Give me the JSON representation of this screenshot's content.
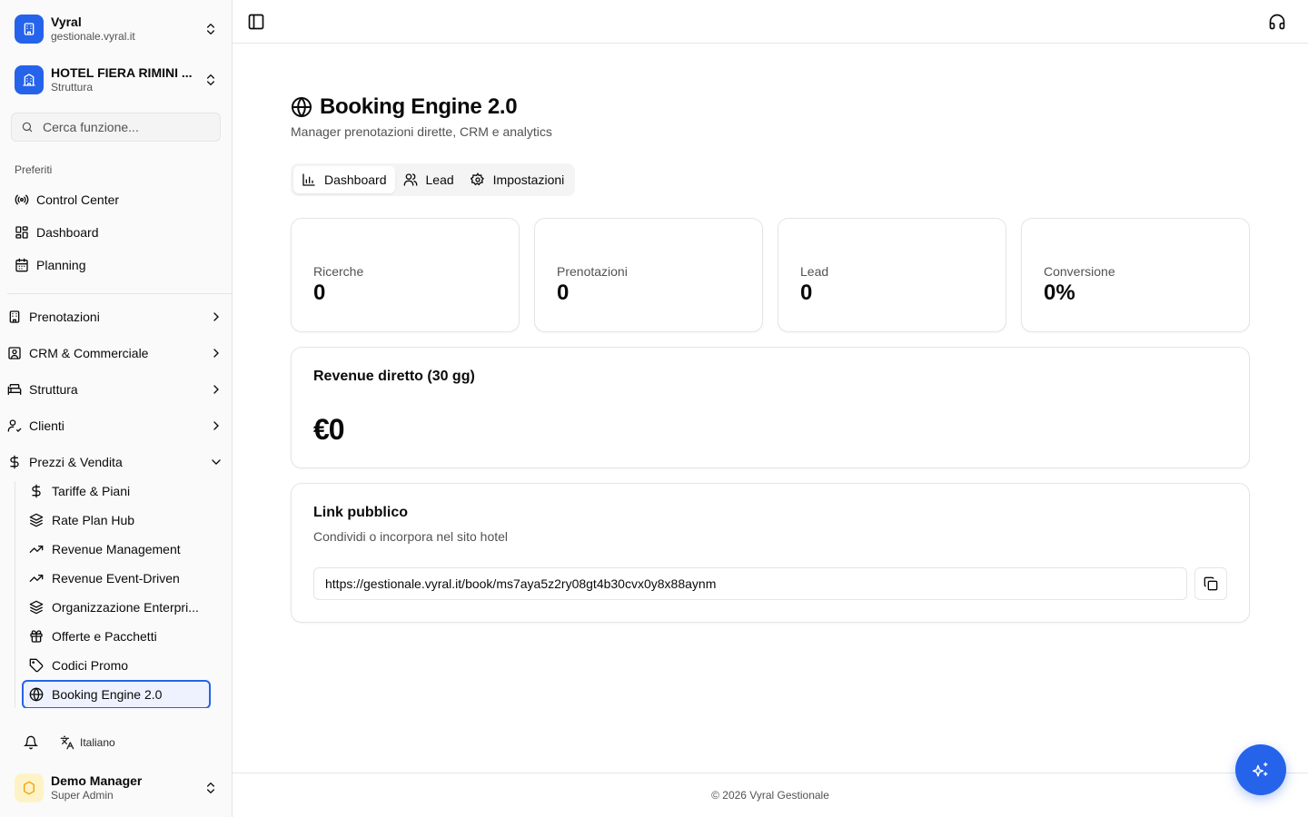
{
  "colors": {
    "accent": "#2563eb",
    "muted_text": "#525252",
    "border": "#e5e5e5",
    "sidebar_bg": "#fafafa"
  },
  "org_switcher": {
    "name": "Vyral",
    "domain": "gestionale.vyral.it",
    "icon": "building-icon"
  },
  "property_switcher": {
    "name": "HOTEL FIERA RIMINI ...",
    "type": "Struttura",
    "icon": "hotel-icon"
  },
  "search": {
    "placeholder": "Cerca funzione..."
  },
  "favorites": {
    "label": "Preferiti",
    "items": [
      {
        "label": "Control Center",
        "icon": "radio-icon"
      },
      {
        "label": "Dashboard",
        "icon": "layout-grid-icon"
      },
      {
        "label": "Planning",
        "icon": "calendar-icon"
      }
    ]
  },
  "nav_groups": [
    {
      "label": "Prenotazioni",
      "icon": "building-icon",
      "expanded": false
    },
    {
      "label": "CRM & Commerciale",
      "icon": "contact-icon",
      "expanded": false
    },
    {
      "label": "Struttura",
      "icon": "bed-icon",
      "expanded": false
    },
    {
      "label": "Clienti",
      "icon": "user-check-icon",
      "expanded": false
    },
    {
      "label": "Prezzi & Vendita",
      "icon": "dollar-icon",
      "expanded": true
    }
  ],
  "pricing_items": [
    {
      "label": "Tariffe & Piani",
      "icon": "dollar-icon"
    },
    {
      "label": "Rate Plan Hub",
      "icon": "layers-icon"
    },
    {
      "label": "Revenue Management",
      "icon": "trending-up-icon"
    },
    {
      "label": "Revenue Event-Driven",
      "icon": "trending-up-icon"
    },
    {
      "label": "Organizzazione Enterpri...",
      "icon": "layers-icon"
    },
    {
      "label": "Offerte e Pacchetti",
      "icon": "gift-icon"
    },
    {
      "label": "Codici Promo",
      "icon": "tag-icon"
    },
    {
      "label": "Booking Engine 2.0",
      "icon": "globe-icon",
      "active": true
    }
  ],
  "bottom": {
    "language": "Italiano"
  },
  "user": {
    "name": "Demo Manager",
    "role": "Super Admin"
  },
  "page": {
    "title": "Booking Engine 2.0",
    "subtitle": "Manager prenotazioni dirette, CRM e analytics",
    "tabs": [
      {
        "label": "Dashboard",
        "icon": "bar-chart-icon",
        "active": true
      },
      {
        "label": "Lead",
        "icon": "users-icon",
        "active": false
      },
      {
        "label": "Impostazioni",
        "icon": "settings-icon",
        "active": false
      }
    ],
    "stats": [
      {
        "label": "Ricerche",
        "value": "0"
      },
      {
        "label": "Prenotazioni",
        "value": "0"
      },
      {
        "label": "Lead",
        "value": "0"
      },
      {
        "label": "Conversione",
        "value": "0%"
      }
    ],
    "revenue": {
      "title": "Revenue diretto (30 gg)",
      "value": "€0"
    },
    "public_link": {
      "title": "Link pubblico",
      "subtitle": "Condividi o incorpora nel sito hotel",
      "url": "https://gestionale.vyral.it/book/ms7aya5z2ry08gt4b30cvx0y8x88aynm"
    }
  },
  "footer": {
    "text": "© 2026 Vyral Gestionale"
  }
}
